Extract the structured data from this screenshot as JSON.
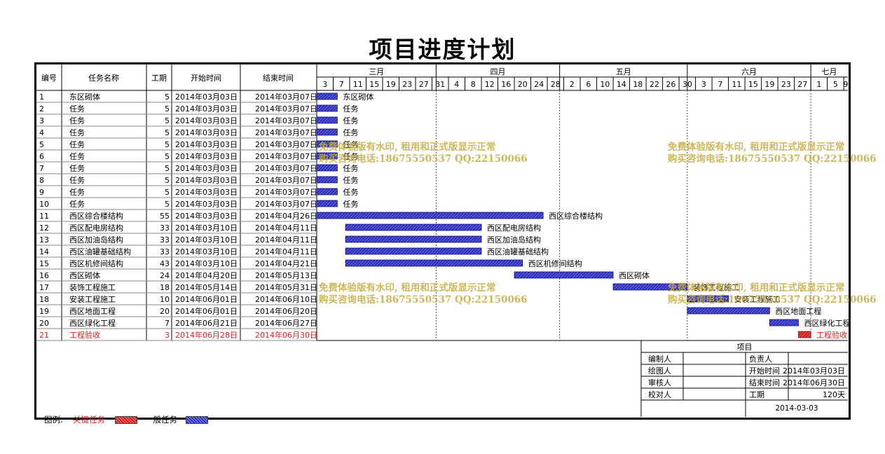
{
  "title": "项目进度计划",
  "colors": {
    "normal": "#3030c0",
    "critical": "#cc2020",
    "watermark": "#c4aa3c"
  },
  "chart_data": {
    "type": "gantt",
    "columns": [
      "编号",
      "任务名称",
      "工期",
      "开始时间",
      "结束时间"
    ],
    "axis": {
      "start": "2014-03-03",
      "end": "2014-07-10",
      "months": [
        {
          "label": "三月",
          "from": "2014-03-01"
        },
        {
          "label": "四月",
          "from": "2014-04-01"
        },
        {
          "label": "五月",
          "from": "2014-05-01"
        },
        {
          "label": "六月",
          "from": "2014-06-01"
        },
        {
          "label": "七月",
          "from": "2014-07-01"
        }
      ],
      "ticks": [
        "2014-03-03",
        "2014-03-07",
        "2014-03-11",
        "2014-03-15",
        "2014-03-19",
        "2014-03-23",
        "2014-03-27",
        "2014-03-31",
        "2014-04-04",
        "2014-04-08",
        "2014-04-12",
        "2014-04-16",
        "2014-04-20",
        "2014-04-24",
        "2014-04-28",
        "2014-05-02",
        "2014-05-06",
        "2014-05-10",
        "2014-05-14",
        "2014-05-18",
        "2014-05-22",
        "2014-05-26",
        "2014-05-30",
        "2014-06-03",
        "2014-06-07",
        "2014-06-11",
        "2014-06-15",
        "2014-06-19",
        "2014-06-23",
        "2014-06-27",
        "2014-07-01",
        "2014-07-05",
        "2014-07-09"
      ],
      "tick_labels": [
        "3",
        "7",
        "11",
        "15",
        "19",
        "23",
        "27",
        "31",
        "4",
        "8",
        "12",
        "16",
        "20",
        "24",
        "28",
        "2",
        "6",
        "10",
        "14",
        "18",
        "22",
        "26",
        "30",
        "3",
        "7",
        "11",
        "15",
        "19",
        "23",
        "27",
        "1",
        "5",
        "9"
      ]
    },
    "tasks": [
      {
        "id": "1",
        "name": "东区砌体",
        "duration": 5,
        "start": "2014年03月03日",
        "end": "2014年03月07日",
        "s": "2014-03-03",
        "e": "2014-03-07",
        "critical": false,
        "label": "东区砌体"
      },
      {
        "id": "2",
        "name": "任务",
        "duration": 5,
        "start": "2014年03月03日",
        "end": "2014年03月07日",
        "s": "2014-03-03",
        "e": "2014-03-07",
        "critical": false,
        "label": "任务"
      },
      {
        "id": "3",
        "name": "任务",
        "duration": 5,
        "start": "2014年03月03日",
        "end": "2014年03月07日",
        "s": "2014-03-03",
        "e": "2014-03-07",
        "critical": false,
        "label": "任务"
      },
      {
        "id": "4",
        "name": "任务",
        "duration": 5,
        "start": "2014年03月03日",
        "end": "2014年03月07日",
        "s": "2014-03-03",
        "e": "2014-03-07",
        "critical": false,
        "label": "任务"
      },
      {
        "id": "5",
        "name": "任务",
        "duration": 5,
        "start": "2014年03月03日",
        "end": "2014年03月07日",
        "s": "2014-03-03",
        "e": "2014-03-07",
        "critical": false,
        "label": "任务"
      },
      {
        "id": "6",
        "name": "任务",
        "duration": 5,
        "start": "2014年03月03日",
        "end": "2014年03月07日",
        "s": "2014-03-03",
        "e": "2014-03-07",
        "critical": false,
        "label": "任务"
      },
      {
        "id": "7",
        "name": "任务",
        "duration": 5,
        "start": "2014年03月03日",
        "end": "2014年03月07日",
        "s": "2014-03-03",
        "e": "2014-03-07",
        "critical": false,
        "label": "任务"
      },
      {
        "id": "8",
        "name": "任务",
        "duration": 5,
        "start": "2014年03月03日",
        "end": "2014年03月07日",
        "s": "2014-03-03",
        "e": "2014-03-07",
        "critical": false,
        "label": "任务"
      },
      {
        "id": "9",
        "name": "任务",
        "duration": 5,
        "start": "2014年03月03日",
        "end": "2014年03月07日",
        "s": "2014-03-03",
        "e": "2014-03-07",
        "critical": false,
        "label": "任务"
      },
      {
        "id": "10",
        "name": "任务",
        "duration": 5,
        "start": "2014年03月03日",
        "end": "2014年03月07日",
        "s": "2014-03-03",
        "e": "2014-03-07",
        "critical": false,
        "label": "任务"
      },
      {
        "id": "11",
        "name": "西区综合楼结构",
        "duration": 55,
        "start": "2014年03月03日",
        "end": "2014年04月26日",
        "s": "2014-03-03",
        "e": "2014-04-26",
        "critical": false,
        "label": "西区综合楼结构"
      },
      {
        "id": "12",
        "name": "西区配电房结构",
        "duration": 33,
        "start": "2014年03月10日",
        "end": "2014年04月11日",
        "s": "2014-03-10",
        "e": "2014-04-11",
        "critical": false,
        "label": "西区配电房结构"
      },
      {
        "id": "13",
        "name": "西区加油岛结构",
        "duration": 33,
        "start": "2014年03月10日",
        "end": "2014年04月11日",
        "s": "2014-03-10",
        "e": "2014-04-11",
        "critical": false,
        "label": "西区加油岛结构"
      },
      {
        "id": "14",
        "name": "西区油罐基础结构",
        "duration": 33,
        "start": "2014年03月10日",
        "end": "2014年04月11日",
        "s": "2014-03-10",
        "e": "2014-04-11",
        "critical": false,
        "label": "西区油罐基础结构"
      },
      {
        "id": "15",
        "name": "西区机修间结构",
        "duration": 43,
        "start": "2014年03月10日",
        "end": "2014年04月21日",
        "s": "2014-03-10",
        "e": "2014-04-21",
        "critical": false,
        "label": "西区机修间结构"
      },
      {
        "id": "16",
        "name": "西区砌体",
        "duration": 24,
        "start": "2014年04月20日",
        "end": "2014年05月13日",
        "s": "2014-04-20",
        "e": "2014-05-13",
        "critical": false,
        "label": "西区砌体"
      },
      {
        "id": "17",
        "name": "装饰工程施工",
        "duration": 18,
        "start": "2014年05月14日",
        "end": "2014年05月31日",
        "s": "2014-05-14",
        "e": "2014-05-31",
        "critical": false,
        "label": "装饰工程施工"
      },
      {
        "id": "18",
        "name": "安装工程施工",
        "duration": 10,
        "start": "2014年06月01日",
        "end": "2014年06月10日",
        "s": "2014-06-01",
        "e": "2014-06-10",
        "critical": false,
        "label": "安装工程施工"
      },
      {
        "id": "19",
        "name": "西区地面工程",
        "duration": 20,
        "start": "2014年06月01日",
        "end": "2014年06月20日",
        "s": "2014-06-01",
        "e": "2014-06-20",
        "critical": false,
        "label": "西区地面工程"
      },
      {
        "id": "20",
        "name": "西区绿化工程",
        "duration": 7,
        "start": "2014年06月21日",
        "end": "2014年06月27日",
        "s": "2014-06-21",
        "e": "2014-06-27",
        "critical": false,
        "label": "西区绿化工程"
      },
      {
        "id": "21",
        "name": "工程验收",
        "duration": 3,
        "start": "2014年06月28日",
        "end": "2014年06月30日",
        "s": "2014-06-28",
        "e": "2014-06-30",
        "critical": true,
        "label": "工程验收"
      }
    ]
  },
  "legend": {
    "prefix": "图例:",
    "critical": "关键任务",
    "normal": "一般任务"
  },
  "info": {
    "header": "项目",
    "rows": [
      {
        "label": "编制人",
        "value": "",
        "label2": "负责人",
        "value2": ""
      },
      {
        "label": "绘图人",
        "value": "",
        "label2": "开始时间",
        "value2": "2014年03月03日"
      },
      {
        "label": "审核人",
        "value": "",
        "label2": "结束时间",
        "value2": "2014年06月30日"
      },
      {
        "label": "校对人",
        "value": "",
        "label2": "工期",
        "value2": "120天"
      }
    ],
    "date": "2014-03-03"
  },
  "watermark": {
    "line1": "免费体验版有水印, 租用和正式版显示正常",
    "line2": "购买咨询电话:18675550537 QQ:22150066"
  }
}
